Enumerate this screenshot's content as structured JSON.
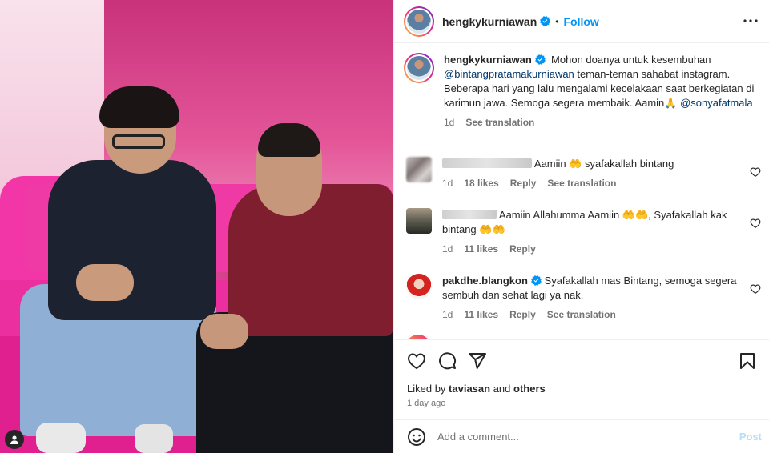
{
  "post": {
    "username": "hengkykurniawan",
    "follow_label": "Follow",
    "dot": "•",
    "caption_parts": [
      {
        "type": "text",
        "value": "Mohon doanya untuk kesembuhan "
      },
      {
        "type": "mention",
        "value": "@bintangpratamakurniawan"
      },
      {
        "type": "text",
        "value": " teman-teman sahabat instagram. Beberapa hari yang lalu mengalami kecelakaan saat berkegiatan di karimun jawa. Semoga segera membaik. Aamin🙏 "
      },
      {
        "type": "mention",
        "value": "@sonyafatmala"
      }
    ],
    "caption_time": "1d",
    "caption_see_translation": "See translation",
    "liked_prefix": "Liked by ",
    "liked_user": "taviasan",
    "liked_and": " and ",
    "liked_others": "others",
    "time_ago": "1 day ago",
    "add_comment_placeholder": "Add a comment...",
    "post_label": "Post"
  },
  "comments": [
    {
      "text": "Aamiin 🤲 syafakallah bintang",
      "time": "1d",
      "likes": "18 likes",
      "reply": "Reply",
      "see_translation": "See translation"
    },
    {
      "text": "Aamiin Allahumma Aamiin 🤲🤲, Syafakallah kak bintang 🤲🤲",
      "time": "1d",
      "likes": "11 likes",
      "reply": "Reply"
    },
    {
      "username": "pakdhe.blangkon",
      "text": "Syafakallah mas Bintang, semoga segera sembuh dan sehat lagi ya nak.",
      "time": "1d",
      "likes": "11 likes",
      "reply": "Reply",
      "see_translation": "See translation"
    }
  ],
  "icons": {
    "verified": "verified-badge-icon",
    "more": "more-options-icon",
    "heart": "heart-icon",
    "comment": "comment-icon",
    "share": "share-icon",
    "save": "bookmark-icon",
    "emoji": "emoji-icon",
    "user_tag": "user-tag-icon"
  },
  "colors": {
    "link_blue": "#0095f6",
    "mention": "#00376b",
    "muted": "#737373",
    "post_disabled": "#b2dffc"
  }
}
